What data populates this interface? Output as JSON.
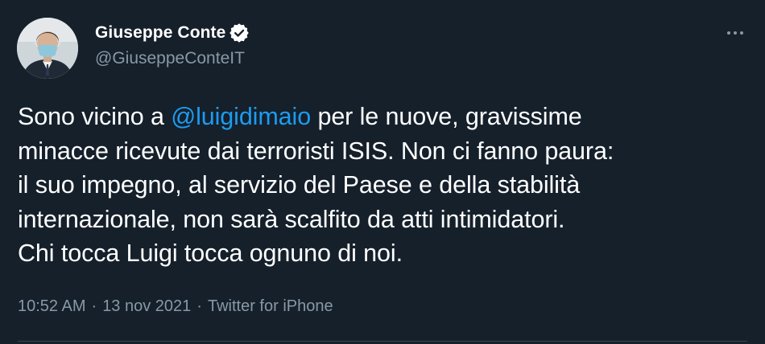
{
  "author": {
    "display_name": "Giuseppe Conte",
    "handle": "@GiuseppeConteIT",
    "verified_icon": "verified-badge-icon"
  },
  "more_icon": "more-horizontal-icon",
  "tweet": {
    "lines": [
      {
        "before": "Sono vicino a ",
        "mention": "@luigidimaio",
        "after": " per le nuove, gravissime"
      },
      {
        "text": "minacce ricevute dai terroristi ISIS. Non ci fanno paura:"
      },
      {
        "text": "il suo impegno, al servizio del Paese e della stabilità"
      },
      {
        "text": "internazionale, non sarà scalfito da atti intimidatori."
      },
      {
        "text": "Chi tocca Luigi tocca ognuno di noi."
      }
    ]
  },
  "meta": {
    "time": "10:52 AM",
    "separator": "·",
    "date": "13 nov 2021",
    "source": "Twitter for iPhone"
  },
  "colors": {
    "background": "#15202b",
    "text": "#ffffff",
    "secondary_text": "#8899a6",
    "link": "#1d9bf0"
  }
}
